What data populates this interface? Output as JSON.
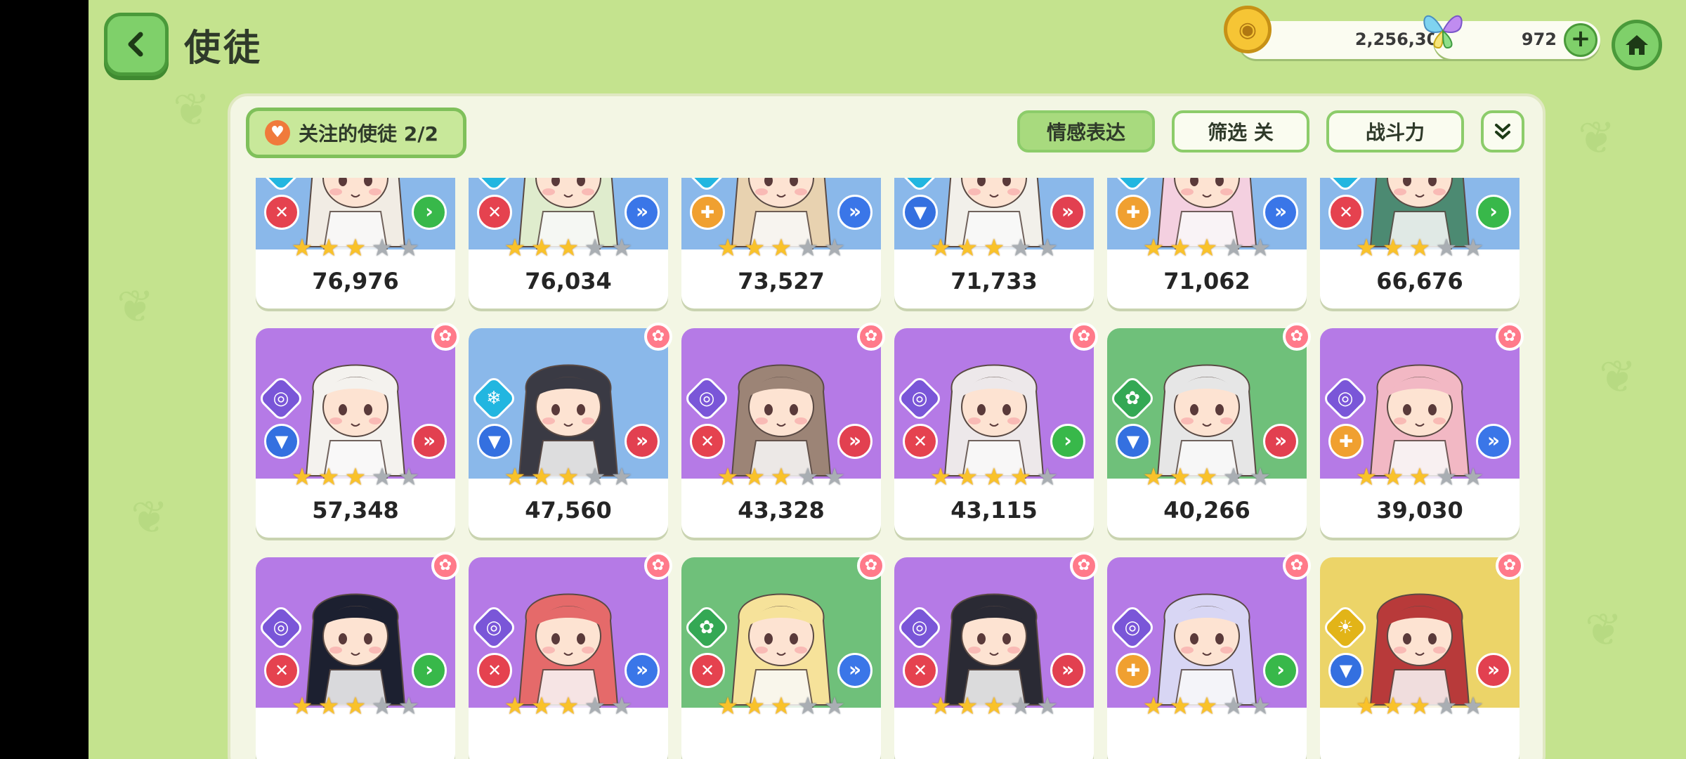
{
  "header": {
    "title": "使徒"
  },
  "currency": {
    "gold": "2,256,306",
    "gems": "972",
    "plus_symbol": "+"
  },
  "icons": {
    "gold": "gold-coin-icon",
    "gem": "butterfly-gem-icon",
    "home": "home-icon",
    "back": "back-arrow-icon"
  },
  "toolbar": {
    "favorites_label": "关注的使徒  2/2",
    "emotion_label": "情感表达",
    "filter_label": "筛选 关",
    "power_label": "战斗力",
    "expand_symbol": "⌄"
  },
  "cards": [
    {
      "power": "76,976",
      "bg": "blue",
      "element": "ice",
      "role": "atk",
      "rank": "green",
      "stars": 3,
      "fav": false
    },
    {
      "power": "76,034",
      "bg": "blue",
      "element": "ice",
      "role": "atk",
      "rank": "blue",
      "stars": 3,
      "fav": false
    },
    {
      "power": "73,527",
      "bg": "blue",
      "element": "ice",
      "role": "sup",
      "rank": "blue",
      "stars": 3,
      "fav": false
    },
    {
      "power": "71,733",
      "bg": "blue",
      "element": "ice",
      "role": "def",
      "rank": "red",
      "stars": 3,
      "fav": false
    },
    {
      "power": "71,062",
      "bg": "blue",
      "element": "ice",
      "role": "sup",
      "rank": "blue",
      "stars": 3,
      "fav": false
    },
    {
      "power": "66,676",
      "bg": "blue",
      "element": "ice",
      "role": "atk",
      "rank": "green",
      "stars": 3,
      "fav": false
    },
    {
      "power": "57,348",
      "bg": "purple",
      "element": "void",
      "role": "def",
      "rank": "red",
      "stars": 3,
      "fav": true
    },
    {
      "power": "47,560",
      "bg": "blue",
      "element": "ice",
      "role": "def",
      "rank": "red",
      "stars": 3,
      "fav": true
    },
    {
      "power": "43,328",
      "bg": "purple",
      "element": "void",
      "role": "atk",
      "rank": "red",
      "stars": 3,
      "fav": true
    },
    {
      "power": "43,115",
      "bg": "purple",
      "element": "void",
      "role": "atk",
      "rank": "green",
      "stars": 4,
      "fav": true
    },
    {
      "power": "40,266",
      "bg": "green",
      "element": "nature",
      "role": "def",
      "rank": "red",
      "stars": 3,
      "fav": true
    },
    {
      "power": "39,030",
      "bg": "purple",
      "element": "void",
      "role": "sup",
      "rank": "blue",
      "stars": 3,
      "fav": true
    },
    {
      "power": "",
      "bg": "purple",
      "element": "void",
      "role": "atk",
      "rank": "green",
      "stars": 3,
      "fav": true
    },
    {
      "power": "",
      "bg": "purple",
      "element": "void",
      "role": "atk",
      "rank": "blue",
      "stars": 3,
      "fav": true
    },
    {
      "power": "",
      "bg": "green",
      "element": "nature",
      "role": "atk",
      "rank": "blue",
      "stars": 3,
      "fav": true
    },
    {
      "power": "",
      "bg": "purple",
      "element": "void",
      "role": "atk",
      "rank": "red",
      "stars": 3,
      "fav": true
    },
    {
      "power": "",
      "bg": "purple",
      "element": "void",
      "role": "sup",
      "rank": "green",
      "stars": 3,
      "fav": true
    },
    {
      "power": "",
      "bg": "yellow",
      "element": "light",
      "role": "def",
      "rank": "red",
      "stars": 3,
      "fav": true
    }
  ]
}
